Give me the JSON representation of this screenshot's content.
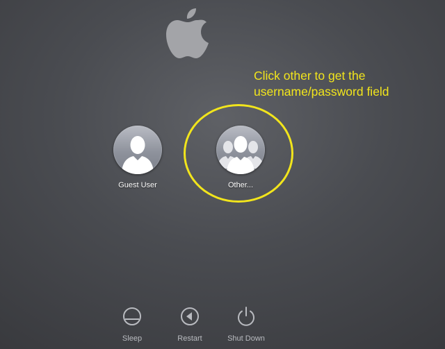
{
  "screen": {
    "annotation_line1": "Click other to get the",
    "annotation_line2": "username/password field"
  },
  "users": [
    {
      "name": "Guest User",
      "icon": "single-user-silhouette-icon"
    },
    {
      "name": "Other...",
      "icon": "multiple-users-silhouette-icon"
    }
  ],
  "power": {
    "sleep_label": "Sleep",
    "restart_label": "Restart",
    "shutdown_label": "Shut Down"
  },
  "colors": {
    "annotation": "#f2e51c",
    "background": "#4a4c51"
  }
}
